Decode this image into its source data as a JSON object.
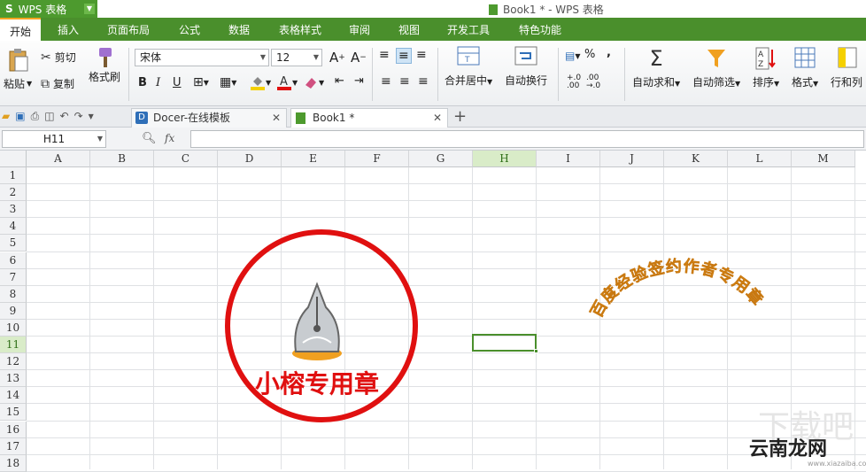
{
  "titlebar": {
    "app_name": "WPS 表格",
    "window_title": "Book1 * - WPS 表格"
  },
  "menu": {
    "tabs": [
      "开始",
      "插入",
      "页面布局",
      "公式",
      "数据",
      "表格样式",
      "审阅",
      "视图",
      "开发工具",
      "特色功能"
    ],
    "active": "开始"
  },
  "ribbon": {
    "paste": "粘贴",
    "cut": "剪切",
    "copy": "复制",
    "format_painter": "格式刷",
    "font_name": "宋体",
    "font_size": "12",
    "merge_center": "合并居中",
    "wrap_text": "自动换行",
    "autosum": "自动求和",
    "autofilter": "自动筛选",
    "sort": "排序",
    "format": "格式",
    "rows_cols": "行和列"
  },
  "doctabs": [
    {
      "label": "Docer-在线模板"
    },
    {
      "label": "Book1 *"
    }
  ],
  "formula": {
    "name_box": "H11",
    "fx": "fx",
    "value": ""
  },
  "sheet": {
    "columns": [
      "A",
      "B",
      "C",
      "D",
      "E",
      "F",
      "G",
      "H",
      "I",
      "J",
      "K",
      "L",
      "M"
    ],
    "rows": [
      "1",
      "2",
      "3",
      "4",
      "5",
      "6",
      "7",
      "8",
      "9",
      "10",
      "11",
      "12",
      "13",
      "14",
      "15",
      "16",
      "17",
      "18"
    ],
    "selected_col": "H",
    "selected_row": "11"
  },
  "stamp": {
    "text": "小榕专用章",
    "color": "#e01010"
  },
  "arc_stamp": {
    "text": "百度经验签约作者专用章",
    "color": "#f0a020"
  },
  "watermark": {
    "brand": "云南龙网",
    "url": "www.xiazaiba.com",
    "big": "下载吧"
  },
  "colors": {
    "accent": "#4a8f2c",
    "selection": "#4a8f2c"
  }
}
